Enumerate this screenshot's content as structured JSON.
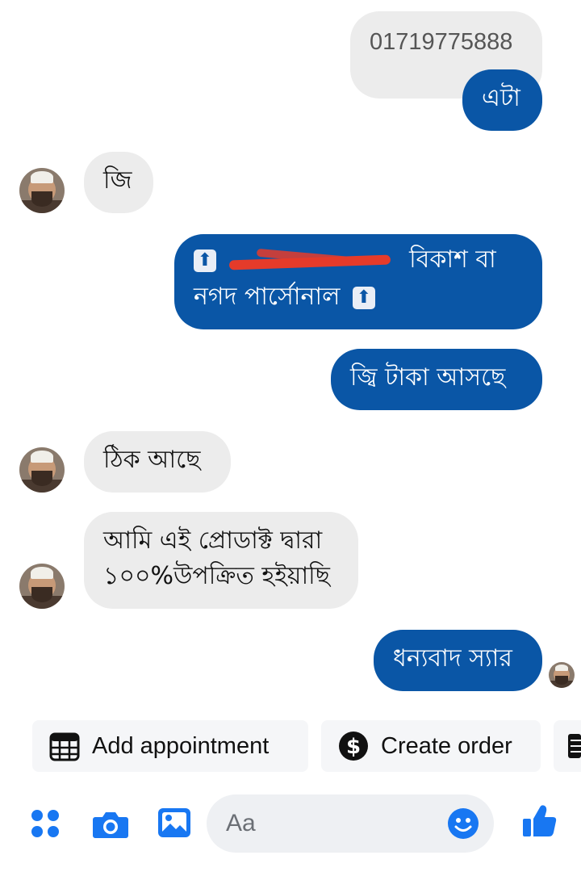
{
  "messages": [
    {
      "id": "m1",
      "sender": "me",
      "text": "01719775888",
      "style": "faded"
    },
    {
      "id": "m2",
      "sender": "me",
      "text": "এটা"
    },
    {
      "id": "m3",
      "sender": "them",
      "text": "জি"
    },
    {
      "id": "m4",
      "sender": "me",
      "line1_suffix": "বিকাশ বা",
      "line2": "নগদ পার্সোনাল",
      "note": "number redacted"
    },
    {
      "id": "m5",
      "sender": "me",
      "text": "জ্বি টাকা আসছে"
    },
    {
      "id": "m6",
      "sender": "them",
      "text": "ঠিক আছে"
    },
    {
      "id": "m7",
      "sender": "them",
      "line1": "আমি এই প্রোডাক্ট দ্বারা",
      "line2": "১০০%উপক্রিত হইয়াছি"
    },
    {
      "id": "m8",
      "sender": "me",
      "text": "ধন্যবাদ স্যার"
    }
  ],
  "quick_actions": {
    "add_appointment": "Add appointment",
    "create_order": "Create order"
  },
  "composer": {
    "placeholder": "Aa",
    "icons": [
      "menu-dots-icon",
      "camera-icon",
      "image-icon",
      "emoji-icon",
      "like-icon"
    ]
  },
  "colors": {
    "outgoing": "#0a56a6",
    "incoming": "#ececec",
    "accent": "#1877f2"
  }
}
